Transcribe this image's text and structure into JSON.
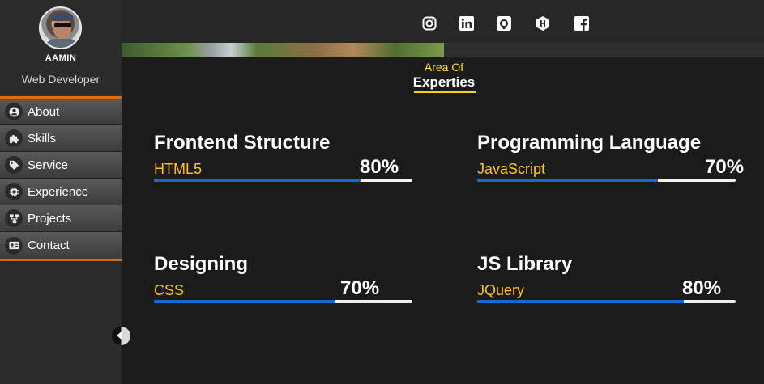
{
  "profile": {
    "name": "AAMIN",
    "role": "Web Developer"
  },
  "social": [
    {
      "icon": "instagram-icon"
    },
    {
      "icon": "linkedin-icon"
    },
    {
      "icon": "github-icon"
    },
    {
      "icon": "hashnode-icon"
    },
    {
      "icon": "facebook-icon"
    }
  ],
  "menu": [
    {
      "label": "About",
      "icon": "user-icon"
    },
    {
      "label": "Skills",
      "icon": "puzzle-icon"
    },
    {
      "label": "Service",
      "icon": "tag-icon"
    },
    {
      "label": "Experience",
      "icon": "chip-icon"
    },
    {
      "label": "Projects",
      "icon": "sitemap-icon"
    },
    {
      "label": "Contact",
      "icon": "id-card-icon"
    }
  ],
  "section": {
    "subtitle": "Area Of",
    "title": "Experties"
  },
  "skills": [
    {
      "category": "Frontend Structure",
      "name": "HTML5",
      "percent_label": "80%",
      "level": 0.8
    },
    {
      "category": "Programming Language",
      "name": "JavaScript",
      "percent_label": "70%",
      "level": 0.7
    },
    {
      "category": "Designing",
      "name": "CSS",
      "percent_label": "70%",
      "level": 0.7
    },
    {
      "category": "JS Library",
      "name": "JQuery",
      "percent_label": "80%",
      "level": 0.8
    }
  ],
  "colors": {
    "accent": "#e06a10",
    "bar": "#1666d4",
    "skill_name": "#ffc21a",
    "heading_sub": "#ffe11a"
  }
}
